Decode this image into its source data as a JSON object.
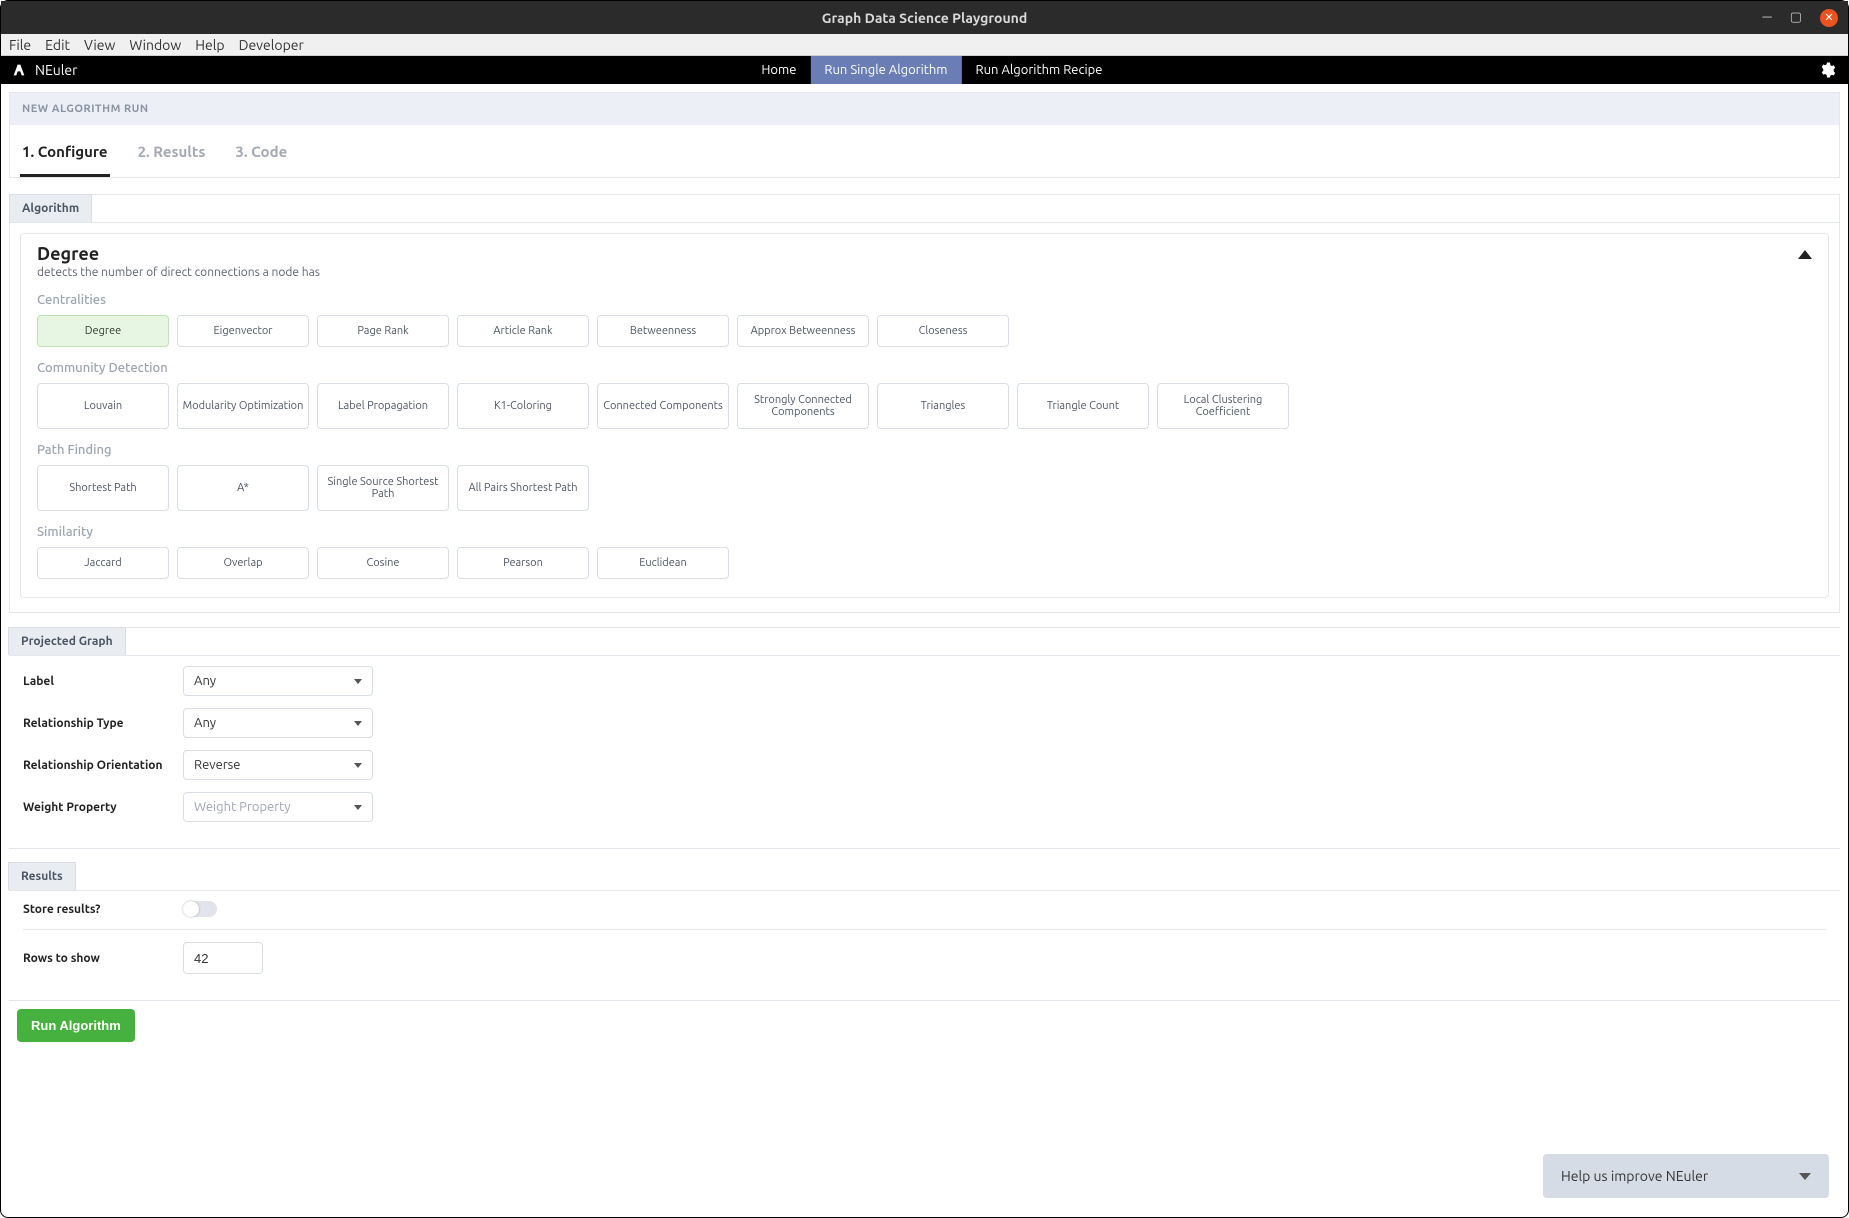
{
  "window": {
    "title": "Graph Data Science Playground"
  },
  "menu": [
    "File",
    "Edit",
    "View",
    "Window",
    "Help",
    "Developer"
  ],
  "app": {
    "name": "NEuler"
  },
  "nav": {
    "tabs": [
      {
        "label": "Home",
        "active": false
      },
      {
        "label": "Run Single Algorithm",
        "active": true
      },
      {
        "label": "Run Algorithm Recipe",
        "active": false
      }
    ]
  },
  "sectionTitle": "NEW ALGORITHM RUN",
  "steps": [
    {
      "label": "1. Configure",
      "active": true
    },
    {
      "label": "2. Results",
      "active": false
    },
    {
      "label": "3. Code",
      "active": false
    }
  ],
  "algorithmPanel": {
    "tab": "Algorithm",
    "selected": {
      "name": "Degree",
      "description": "detects the number of direct connections a node has"
    },
    "categories": [
      {
        "label": "Centralities",
        "tall": false,
        "items": [
          "Degree",
          "Eigenvector",
          "Page Rank",
          "Article Rank",
          "Betweenness",
          "Approx Betweenness",
          "Closeness"
        ]
      },
      {
        "label": "Community Detection",
        "tall": true,
        "items": [
          "Louvain",
          "Modularity Optimization",
          "Label Propagation",
          "K1-Coloring",
          "Connected Components",
          "Strongly Connected Components",
          "Triangles",
          "Triangle Count",
          "Local Clustering Coefficient"
        ]
      },
      {
        "label": "Path Finding",
        "tall": true,
        "items": [
          "Shortest Path",
          "A*",
          "Single Source Shortest Path",
          "All Pairs Shortest Path"
        ]
      },
      {
        "label": "Similarity",
        "tall": false,
        "items": [
          "Jaccard",
          "Overlap",
          "Cosine",
          "Pearson",
          "Euclidean"
        ]
      }
    ]
  },
  "projectedGraph": {
    "tab": "Projected Graph",
    "fields": {
      "label": {
        "label": "Label",
        "value": "Any"
      },
      "relationshipType": {
        "label": "Relationship Type",
        "value": "Any"
      },
      "relationshipOrientation": {
        "label": "Relationship Orientation",
        "value": "Reverse"
      },
      "weightProperty": {
        "label": "Weight Property",
        "placeholder": "Weight Property"
      }
    }
  },
  "results": {
    "tab": "Results",
    "storeLabel": "Store results?",
    "storeValue": false,
    "rowsLabel": "Rows to show",
    "rowsValue": "42"
  },
  "runButton": "Run Algorithm",
  "helpWidget": "Help us improve NEuler"
}
